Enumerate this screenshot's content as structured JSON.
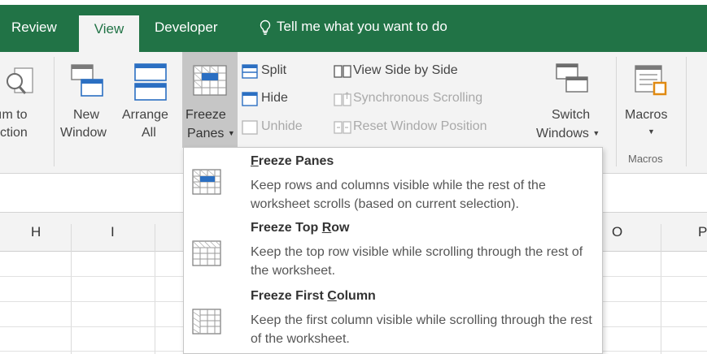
{
  "tabs": [
    {
      "label": "Review",
      "active": false
    },
    {
      "label": "View",
      "active": true
    },
    {
      "label": "Developer",
      "active": false
    }
  ],
  "tell_me": "Tell me what you want to do",
  "ribbon": {
    "zoom_to_selection": {
      "line1": "ım to",
      "line2": "ction"
    },
    "new_window": {
      "line1": "New",
      "line2": "Window"
    },
    "arrange_all": {
      "line1": "Arrange",
      "line2": "All"
    },
    "freeze_panes": {
      "line1": "Freeze",
      "line2": "Panes"
    },
    "split": "Split",
    "hide": "Hide",
    "unhide": "Unhide",
    "view_side_by_side": "View Side by Side",
    "synchronous_scrolling": "Synchronous Scrolling",
    "reset_window_position": "Reset Window Position",
    "switch_windows": {
      "line1": "Switch",
      "line2": "Windows"
    },
    "macros": {
      "label": "Macros",
      "group": "Macros"
    }
  },
  "columns": [
    "H",
    "I",
    "O",
    "P"
  ],
  "freeze_menu": [
    {
      "title_key": "F",
      "title_rest": "reeze Panes",
      "title_pre": "",
      "desc": "Keep rows and columns visible while the rest of the worksheet scrolls (based on current selection)."
    },
    {
      "title_pre": "Freeze Top ",
      "title_key": "R",
      "title_rest": "ow",
      "desc": "Keep the top row visible while scrolling through the rest of the worksheet."
    },
    {
      "title_pre": "Freeze First ",
      "title_key": "C",
      "title_rest": "olumn",
      "desc": "Keep the first column visible while scrolling through the rest of the worksheet."
    }
  ],
  "colors": {
    "ribbon_green": "#217346",
    "ribbon_bg": "#f3f3f3",
    "accent_blue": "#2b6fc2"
  }
}
